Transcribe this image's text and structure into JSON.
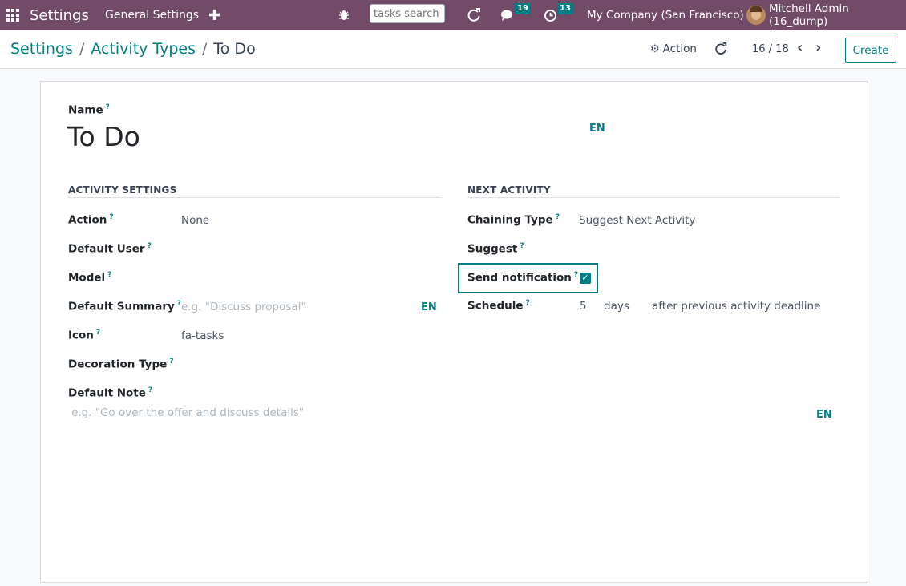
{
  "navbar": {
    "app_name": "Settings",
    "menu_general": "General Settings",
    "search_placeholder": "tasks search",
    "chat_count": "19",
    "activity_count": "13",
    "company": "My Company (San Francisco)",
    "user": "Mitchell Admin (16_dump)",
    "colors": {
      "bg": "#714b67",
      "badge": "#017e84"
    }
  },
  "control_panel": {
    "breadcrumb": {
      "root": "Settings",
      "parent": "Activity Types",
      "current": "To Do"
    },
    "action_label": "Action",
    "pager": "16 / 18",
    "create_label": "Create"
  },
  "form": {
    "name_label": "Name",
    "name_value": "To Do",
    "name_lang": "EN",
    "activity_settings": {
      "title": "ACTIVITY SETTINGS",
      "action_label": "Action",
      "action_value": "None",
      "default_user_label": "Default User",
      "model_label": "Model",
      "default_summary_label": "Default Summary",
      "default_summary_placeholder": "e.g. \"Discuss proposal\"",
      "default_summary_lang": "EN",
      "icon_label": "Icon",
      "icon_value": "fa-tasks",
      "decoration_type_label": "Decoration Type",
      "default_note_label": "Default Note",
      "default_note_placeholder": "e.g. \"Go over the offer and discuss details\"",
      "default_note_lang": "EN"
    },
    "next_activity": {
      "title": "NEXT ACTIVITY",
      "chaining_type_label": "Chaining Type",
      "chaining_type_value": "Suggest Next Activity",
      "suggest_label": "Suggest",
      "send_notification_label": "Send notification",
      "send_notification_checked": true,
      "schedule_label": "Schedule",
      "schedule_value": "5",
      "schedule_unit": "days",
      "schedule_ref": "after previous activity deadline"
    }
  }
}
